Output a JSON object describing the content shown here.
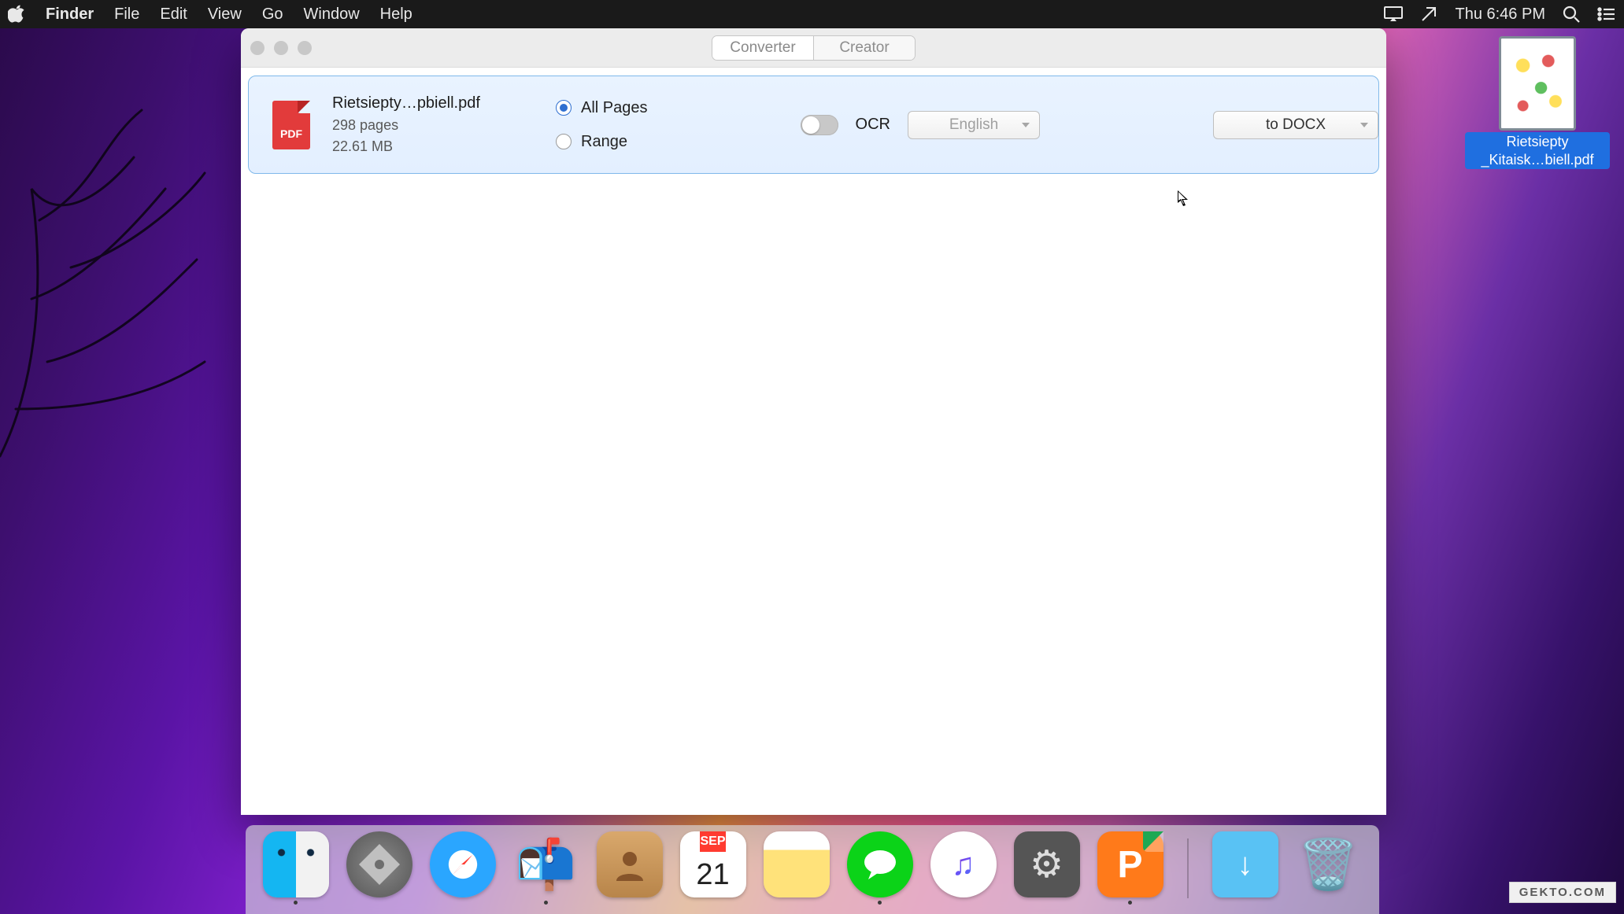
{
  "menubar": {
    "app": "Finder",
    "items": [
      "File",
      "Edit",
      "View",
      "Go",
      "Window",
      "Help"
    ],
    "clock": "Thu 6:46 PM"
  },
  "desktop_file": {
    "line1": "Rietsiepty",
    "line2": "_Kitaisk…biell.pdf"
  },
  "window": {
    "tabs": {
      "converter": "Converter",
      "creator": "Creator"
    },
    "file": {
      "icon_label": "PDF",
      "name": "Rietsiepty…pbiell.pdf",
      "pages": "298 pages",
      "size": "22.61 MB"
    },
    "options": {
      "all_pages": "All Pages",
      "range": "Range",
      "ocr": "OCR",
      "language": "English",
      "format": "to DOCX"
    }
  },
  "dock": {
    "calendar": {
      "month": "SEP",
      "day": "21"
    }
  },
  "watermark": "GEKTO.COM"
}
